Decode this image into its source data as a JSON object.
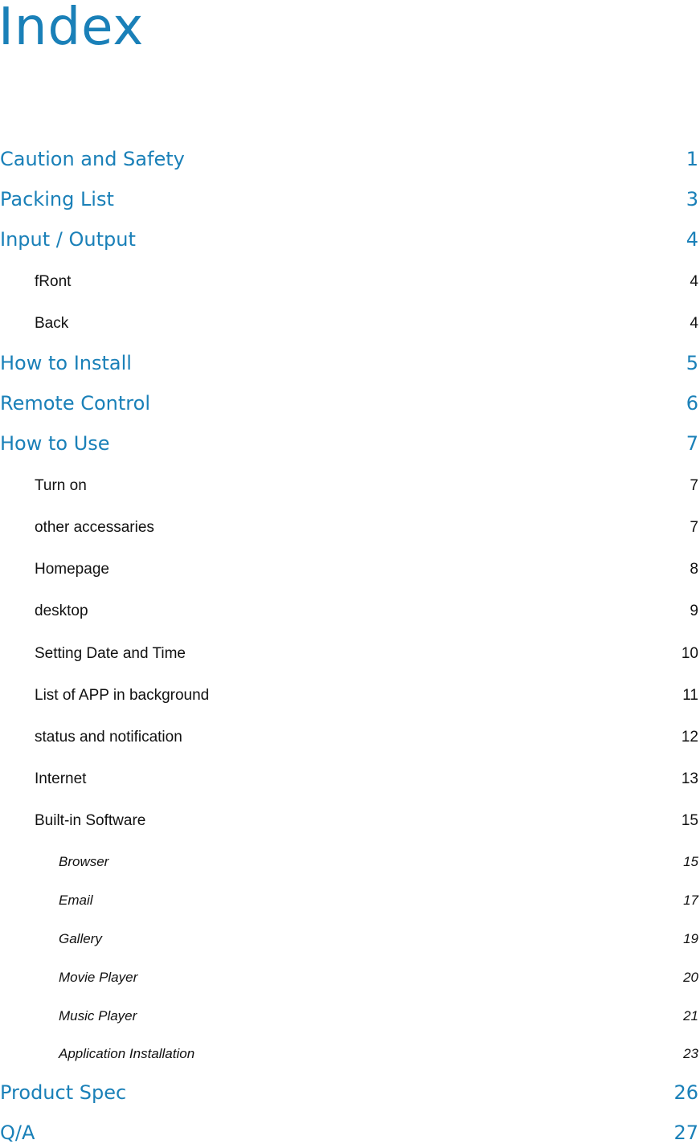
{
  "title": "Index",
  "colors": {
    "accent": "#1a80b8",
    "text": "#111111"
  },
  "entries": [
    {
      "level": 1,
      "label": "Caution and Safety",
      "page": "1"
    },
    {
      "level": 1,
      "label": "Packing List",
      "page": "3"
    },
    {
      "level": 1,
      "label": "Input / Output",
      "page": "4"
    },
    {
      "level": 2,
      "label": "fRont",
      "page": "4"
    },
    {
      "level": 2,
      "label": "Back",
      "page": "4"
    },
    {
      "level": 1,
      "label": "How to Install",
      "page": "5"
    },
    {
      "level": 1,
      "label": "Remote Control",
      "page": "6"
    },
    {
      "level": 1,
      "label": "How to Use",
      "page": "7"
    },
    {
      "level": 2,
      "label": "Turn on",
      "page": "7"
    },
    {
      "level": 2,
      "label": "other accessaries",
      "page": "7"
    },
    {
      "level": 2,
      "label": "Homepage",
      "page": "8"
    },
    {
      "level": 2,
      "label": "desktop",
      "page": "9"
    },
    {
      "level": 2,
      "label": "Setting Date and Time",
      "page": "10"
    },
    {
      "level": 2,
      "label": "List of APP in background",
      "page": "11"
    },
    {
      "level": 2,
      "label": "status and notification",
      "page": "12"
    },
    {
      "level": 2,
      "label": "Internet",
      "page": "13"
    },
    {
      "level": 2,
      "label": "Built-in Software",
      "page": "15"
    },
    {
      "level": 3,
      "label": "Browser",
      "page": "15"
    },
    {
      "level": 3,
      "label": "Email",
      "page": "17"
    },
    {
      "level": 3,
      "label": "Gallery",
      "page": "19"
    },
    {
      "level": 3,
      "label": "Movie Player",
      "page": "20"
    },
    {
      "level": 3,
      "label": "Music Player",
      "page": "21"
    },
    {
      "level": 3,
      "label": "Application Installation",
      "page": "23"
    },
    {
      "level": 1,
      "label": "Product Spec",
      "page": "26"
    },
    {
      "level": 1,
      "label": "Q/A",
      "page": "27"
    }
  ]
}
